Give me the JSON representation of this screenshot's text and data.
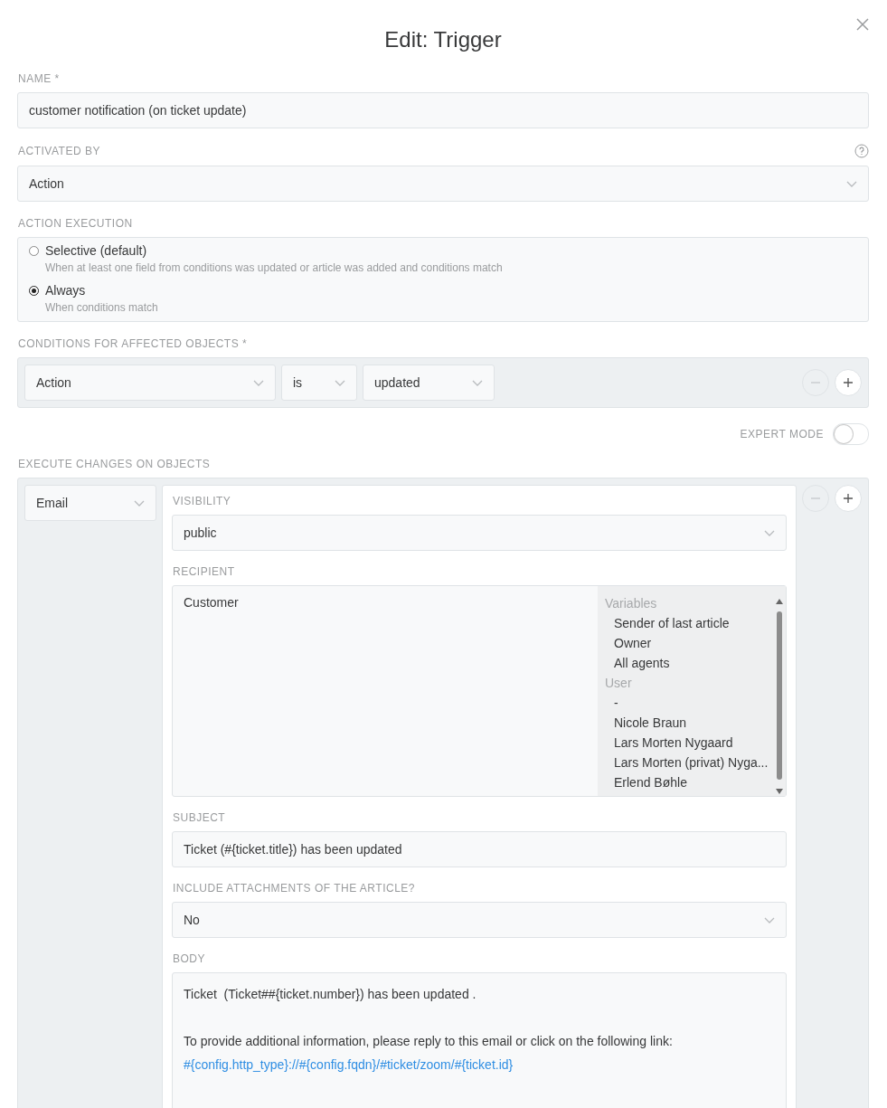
{
  "title": "Edit: Trigger",
  "name": {
    "label": "NAME *",
    "value": "customer notification (on ticket update)"
  },
  "activated_by": {
    "label": "ACTIVATED BY",
    "value": "Action"
  },
  "action_execution": {
    "label": "ACTION EXECUTION",
    "options": [
      {
        "label": "Selective (default)",
        "description": "When at least one field from conditions was updated or article was added and conditions match",
        "selected": false
      },
      {
        "label": "Always",
        "description": "When conditions match",
        "selected": true
      }
    ]
  },
  "conditions": {
    "label": "CONDITIONS FOR AFFECTED OBJECTS *",
    "selects": [
      "Action",
      "is",
      "updated"
    ]
  },
  "expert_mode": {
    "label": "EXPERT MODE",
    "on": false
  },
  "execute": {
    "label": "EXECUTE CHANGES ON OBJECTS",
    "object": "Email",
    "visibility": {
      "label": "VISIBILITY",
      "value": "public"
    },
    "recipient": {
      "label": "RECIPIENT",
      "value": "Customer",
      "groups": [
        {
          "name": "Variables",
          "items": [
            "Sender of last article",
            "Owner",
            "All agents"
          ]
        },
        {
          "name": "User",
          "items": [
            "-",
            "Nicole Braun",
            "Lars Morten Nygaard",
            "Lars Morten (privat) Nyga...",
            "Erlend Bøhle"
          ]
        }
      ]
    },
    "subject": {
      "label": "SUBJECT",
      "value": "Ticket (#{ticket.title}) has been updated"
    },
    "attachments": {
      "label": "INCLUDE ATTACHMENTS OF THE ARTICLE?",
      "value": "No"
    },
    "body": {
      "label": "BODY",
      "paragraphs": [
        {
          "text": "Ticket  (Ticket##{ticket.number}) has been updated ."
        },
        {
          "text": "To provide additional information, please reply to this email or click on the following link:",
          "link": "#{config.http_type}://#{config.fqdn}/#ticket/zoom/#{ticket.id}"
        }
      ]
    }
  }
}
